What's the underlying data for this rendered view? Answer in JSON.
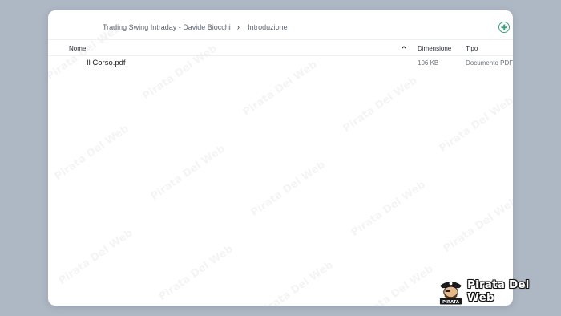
{
  "breadcrumb": {
    "items": [
      "Trading Swing Intraday - Davide Biocchi",
      "Introduzione"
    ],
    "separator": "›"
  },
  "toolbar": {
    "add_icon": "plus-circle-icon",
    "accent_color": "#3aa37a"
  },
  "table": {
    "columns": {
      "name": "Nome",
      "size": "Dimensione",
      "type": "Tipo"
    },
    "sort_icon": "chevron-up-icon",
    "rows": [
      {
        "name": "Il Corso.pdf",
        "size": "106 KB",
        "type": "Documento PDF"
      }
    ]
  },
  "watermark": {
    "text": "Pirata Del Web"
  },
  "brand": {
    "name": "Pirata Del Web",
    "logo_label": "PIRATA"
  }
}
